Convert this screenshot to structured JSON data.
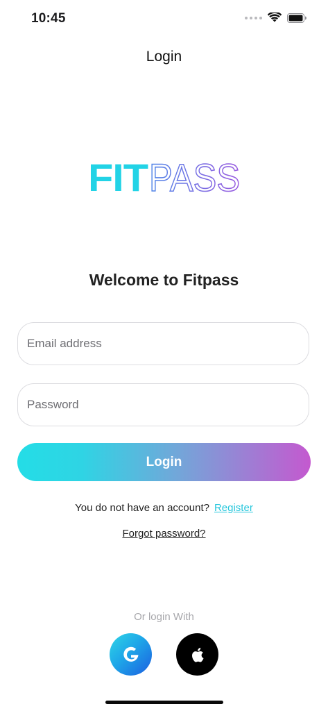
{
  "status_bar": {
    "time": "10:45",
    "icons": [
      "cellular-dots-icon",
      "wifi-icon",
      "battery-icon"
    ]
  },
  "header": {
    "title": "Login"
  },
  "logo": {
    "text_bold": "FIT",
    "text_light": "PASS",
    "colors": {
      "fit": "#22d3e6",
      "pass_start": "#5b7be8",
      "pass_end": "#9a5be0"
    }
  },
  "main": {
    "welcome": "Welcome to Fitpass",
    "email": {
      "placeholder": "Email address",
      "value": ""
    },
    "password": {
      "placeholder": "Password",
      "value": ""
    },
    "login_label": "Login",
    "no_account_text": "You do not have an account?",
    "register_label": "Register",
    "forgot_label": "Forgot password?"
  },
  "social": {
    "heading": "Or login With",
    "google_icon": "google-g-icon",
    "apple_icon": "apple-logo-icon"
  },
  "colors": {
    "accent_cyan": "#27c7dc",
    "gradient_start": "#24dde6",
    "gradient_end": "#c459cf",
    "muted_text": "#a7a7ab",
    "field_border": "#dcdce0"
  }
}
